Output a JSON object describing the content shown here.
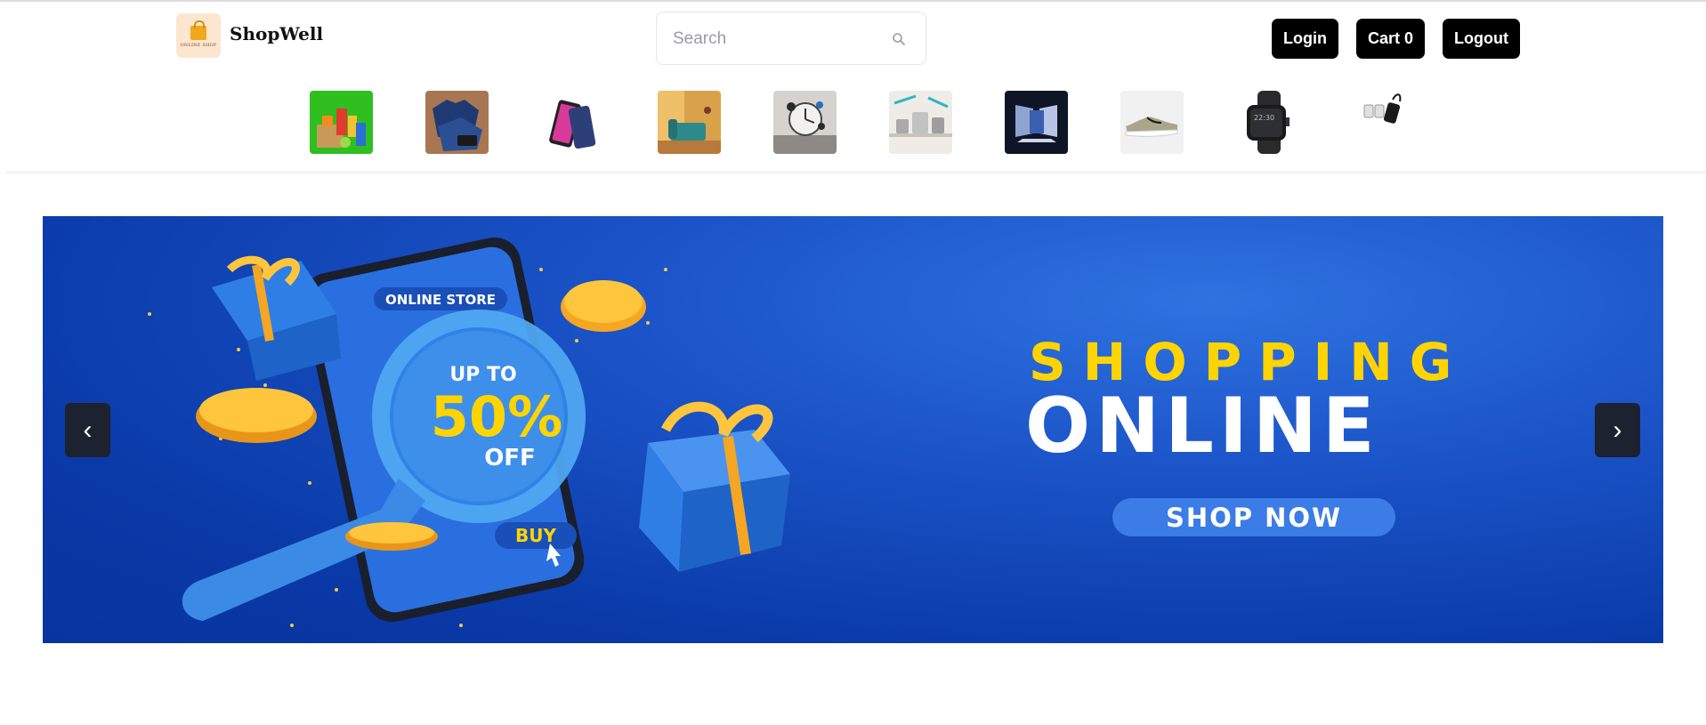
{
  "header": {
    "logo_text": "ONLINE SHOP",
    "brand": "ShopWell",
    "search": {
      "placeholder": "Search"
    },
    "buttons": {
      "login": "Login",
      "cart": "Cart 0",
      "logout": "Logout"
    }
  },
  "categories": [
    {
      "name": "grocery",
      "icon": "grocery-icon"
    },
    {
      "name": "fashion",
      "icon": "shirt-icon"
    },
    {
      "name": "mobiles",
      "icon": "smartphone-icon"
    },
    {
      "name": "furniture",
      "icon": "sofa-icon"
    },
    {
      "name": "decor",
      "icon": "wall-clock-icon"
    },
    {
      "name": "kitchen",
      "icon": "cookware-icon"
    },
    {
      "name": "laptops",
      "icon": "laptop-icon"
    },
    {
      "name": "footwear",
      "icon": "shoe-icon"
    },
    {
      "name": "watches",
      "icon": "smartwatch-icon"
    },
    {
      "name": "accessories",
      "icon": "charger-icon"
    }
  ],
  "banner": {
    "online_store": "ONLINE STORE",
    "up_to": "UP TO",
    "percent": "50%",
    "off": "OFF",
    "buy": "BUY",
    "shopping": "SHOPPING",
    "online": "ONLINE",
    "shop_now": "SHOP NOW",
    "prev": "‹",
    "next": "›"
  },
  "colors": {
    "accent_yellow": "#ffd400",
    "banner_blue": "#1b54c8",
    "button_black": "#000000"
  }
}
